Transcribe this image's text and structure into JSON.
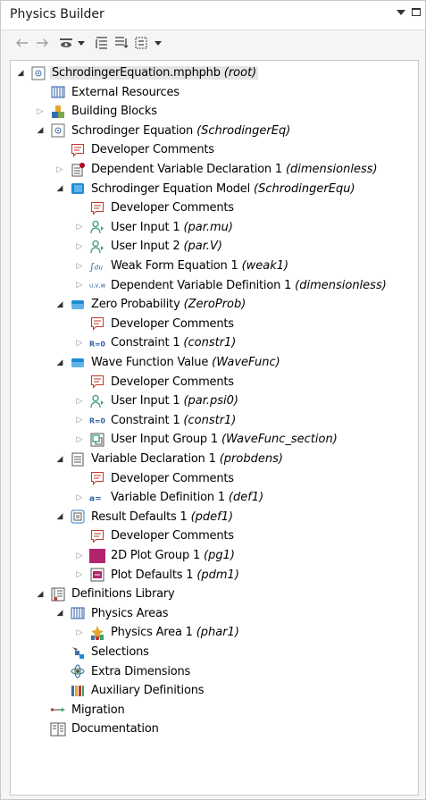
{
  "window": {
    "title": "Physics Builder"
  },
  "colors": {
    "accent": "#1e8cd2",
    "plot": "#b3246e",
    "selected": "#e5e5e5"
  },
  "toolbar": [
    "back-icon",
    "forward-icon",
    "show-icon",
    "collapse-icon",
    "expand-icon",
    "tree-view-icon"
  ],
  "tree": [
    {
      "label": "SchrodingerEquation.mphphb",
      "tag": "(root)",
      "icon": "root-icon",
      "arrow": "open"
    },
    {
      "label": "External Resources",
      "tag": "",
      "icon": "external-resources-icon",
      "arrow": "none"
    },
    {
      "label": "Building Blocks",
      "tag": "",
      "icon": "building-blocks-icon",
      "arrow": "closed"
    },
    {
      "label": "Schrodinger Equation",
      "tag": "(SchrodingerEq)",
      "icon": "physics-interface-icon",
      "arrow": "open"
    },
    {
      "label": "Developer Comments",
      "tag": "",
      "icon": "comment-icon",
      "arrow": "none"
    },
    {
      "label": "Dependent Variable Declaration 1",
      "tag": "(dimensionless)",
      "icon": "dependent-variable-icon",
      "arrow": "closed"
    },
    {
      "label": "Schrodinger Equation Model",
      "tag": "(SchrodingerEqu)",
      "icon": "domain-feature-icon",
      "arrow": "open"
    },
    {
      "label": "Developer Comments",
      "tag": "",
      "icon": "comment-icon",
      "arrow": "none"
    },
    {
      "label": "User Input 1",
      "tag": "(par.mu)",
      "icon": "user-input-icon",
      "arrow": "closed"
    },
    {
      "label": "User Input 2",
      "tag": "(par.V)",
      "icon": "user-input-icon",
      "arrow": "closed"
    },
    {
      "label": "Weak Form Equation 1",
      "tag": "(weak1)",
      "icon": "weak-form-icon",
      "arrow": "closed"
    },
    {
      "label": "Dependent Variable Definition 1",
      "tag": "(dimensionless)",
      "icon": "uvw-icon",
      "arrow": "closed"
    },
    {
      "label": "Zero Probability",
      "tag": "(ZeroProb)",
      "icon": "boundary-feature-icon",
      "arrow": "open"
    },
    {
      "label": "Developer Comments",
      "tag": "",
      "icon": "comment-icon",
      "arrow": "none"
    },
    {
      "label": "Constraint 1",
      "tag": "(constr1)",
      "icon": "constraint-icon",
      "arrow": "closed"
    },
    {
      "label": "Wave Function Value",
      "tag": "(WaveFunc)",
      "icon": "boundary-feature-icon",
      "arrow": "open"
    },
    {
      "label": "Developer Comments",
      "tag": "",
      "icon": "comment-icon",
      "arrow": "none"
    },
    {
      "label": "User Input 1",
      "tag": "(par.psi0)",
      "icon": "user-input-icon",
      "arrow": "closed"
    },
    {
      "label": "Constraint 1",
      "tag": "(constr1)",
      "icon": "constraint-icon",
      "arrow": "closed"
    },
    {
      "label": "User Input Group 1",
      "tag": "(WaveFunc_section)",
      "icon": "user-input-group-icon",
      "arrow": "closed"
    },
    {
      "label": "Variable Declaration 1",
      "tag": "(probdens)",
      "icon": "variable-declaration-icon",
      "arrow": "open"
    },
    {
      "label": "Developer Comments",
      "tag": "",
      "icon": "comment-icon",
      "arrow": "none"
    },
    {
      "label": "Variable Definition 1",
      "tag": "(def1)",
      "icon": "variable-definition-icon",
      "arrow": "closed"
    },
    {
      "label": "Result Defaults 1",
      "tag": "(pdef1)",
      "icon": "result-defaults-icon",
      "arrow": "open"
    },
    {
      "label": "Developer Comments",
      "tag": "",
      "icon": "comment-icon",
      "arrow": "none"
    },
    {
      "label": "2D Plot Group 1",
      "tag": "(pg1)",
      "icon": "plot-group-icon",
      "arrow": "closed"
    },
    {
      "label": "Plot Defaults 1",
      "tag": "(pdm1)",
      "icon": "plot-defaults-icon",
      "arrow": "closed"
    },
    {
      "label": "Definitions Library",
      "tag": "",
      "icon": "definitions-library-icon",
      "arrow": "open"
    },
    {
      "label": "Physics Areas",
      "tag": "",
      "icon": "physics-areas-icon",
      "arrow": "open"
    },
    {
      "label": "Physics Area 1",
      "tag": "(phar1)",
      "icon": "physics-area-icon",
      "arrow": "closed"
    },
    {
      "label": "Selections",
      "tag": "",
      "icon": "selections-icon",
      "arrow": "none"
    },
    {
      "label": "Extra Dimensions",
      "tag": "",
      "icon": "extra-dimensions-icon",
      "arrow": "none"
    },
    {
      "label": "Auxiliary Definitions",
      "tag": "",
      "icon": "auxiliary-definitions-icon",
      "arrow": "none"
    },
    {
      "label": "Migration",
      "tag": "",
      "icon": "migration-icon",
      "arrow": "none"
    },
    {
      "label": "Documentation",
      "tag": "",
      "icon": "documentation-icon",
      "arrow": "none"
    }
  ]
}
